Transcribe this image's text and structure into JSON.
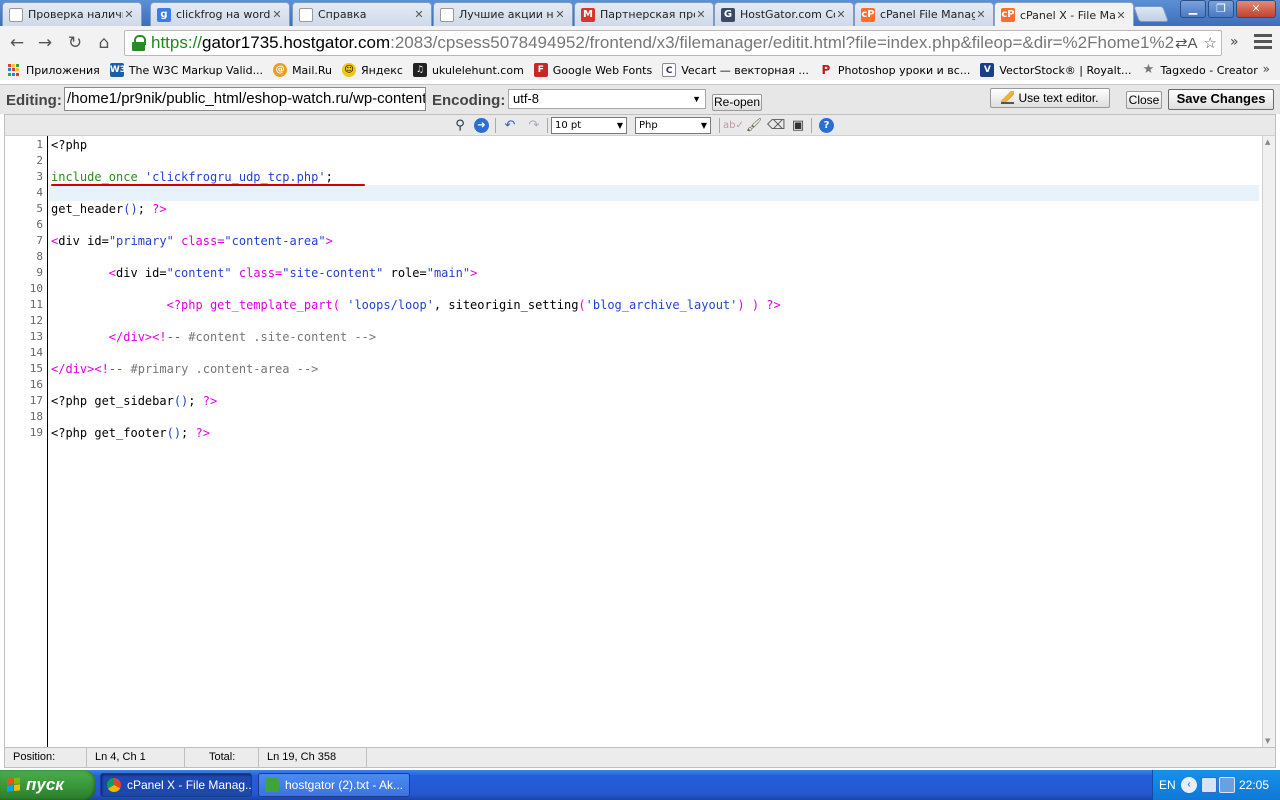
{
  "browser": {
    "tabs": [
      {
        "title": "Проверка наличи",
        "favicon": "doc-icon",
        "color": "#7a7a7a"
      },
      {
        "title": "clickfrog на wordp",
        "favicon": "google-icon",
        "color": "#3b7bea"
      },
      {
        "title": "Справка",
        "favicon": "doc-icon",
        "color": "#7a7a7a"
      },
      {
        "title": "Лучшие акции на",
        "favicon": "doc-icon",
        "color": "#7a7a7a"
      },
      {
        "title": "Партнерская прог",
        "favicon": "m-icon",
        "color": "#d6362b"
      },
      {
        "title": "HostGator.com Co",
        "favicon": "gator-icon",
        "color": "#3a4a66"
      },
      {
        "title": "cPanel File Manag",
        "favicon": "cpanel-icon",
        "color": "#ff6c2c"
      },
      {
        "title": "cPanel X - File Ma",
        "favicon": "cpanel-icon",
        "color": "#ff6c2c"
      }
    ],
    "url": {
      "scheme": "https://",
      "host": "gator1735.hostgator.com",
      "rest": ":2083/cpsess5078494952/frontend/x3/filemanager/editit.html?file=index.php&fileop=&dir=%2Fhome1%2F"
    },
    "bookmarks_apps_label": "Приложения",
    "bookmarks": [
      {
        "label": "The W3C Markup Valid...",
        "icon": "w3c-icon",
        "color": "#1a5fa8",
        "glyph": "W3"
      },
      {
        "label": "Mail.Ru",
        "icon": "mailru-icon",
        "color": "#1a6fd0",
        "glyph": "@"
      },
      {
        "label": "Яндекс",
        "icon": "smiley-icon",
        "color": "#e8c21a",
        "glyph": "☺"
      },
      {
        "label": "ukulelehunt.com",
        "icon": "ukulele-icon",
        "color": "#222222",
        "glyph": "♫"
      },
      {
        "label": "Google Web Fonts",
        "icon": "fonts-icon",
        "color": "#c62828",
        "glyph": "F"
      },
      {
        "label": "Vecart — векторная ...",
        "icon": "vecart-icon",
        "color": "#6a7a8a",
        "glyph": "C"
      },
      {
        "label": "Photoshop уроки и вс...",
        "icon": "photoshop-icon",
        "color": "#b71c1c",
        "glyph": "P"
      },
      {
        "label": "VectorStock® | Royalt...",
        "icon": "vectorstock-icon",
        "color": "#1a3e8a",
        "glyph": "V"
      },
      {
        "label": "Tagxedo - Creator",
        "icon": "star-icon",
        "color": "#777777",
        "glyph": "★"
      }
    ]
  },
  "editor": {
    "editing_label": "Editing:",
    "path_value": "/home1/pr9nik/public_html/eshop-watch.ru/wp-content",
    "encoding_label": "Encoding:",
    "encoding_value": "utf-8",
    "reopen_label": "Re-open",
    "use_text_editor_label": "Use text editor.",
    "close_label": "Close",
    "save_label": "Save Changes",
    "font_size": "10 pt",
    "syntax": "Php",
    "line_numbers": [
      "1",
      "2",
      "3",
      "4",
      "5",
      "6",
      "7",
      "8",
      "9",
      "10",
      "11",
      "12",
      "13",
      "14",
      "15",
      "16",
      "17",
      "18",
      "19"
    ],
    "code": {
      "l1": "<?php",
      "l3_fn": "include_once",
      "l3_str": "'clickfrogru_udp_tcp.php'",
      "l3_end": ";",
      "l5_fn": "get_header",
      "l5_par": "()",
      "l5_end": "; ",
      "l5_close": "?>",
      "l7_open": "<",
      "l7_tag": "div id=",
      "l7_v1": "\"primary\"",
      "l7_a2": " class=",
      "l7_v2": "\"content-area\"",
      "l7_close": ">",
      "l9_indent": "        ",
      "l9_open": "<",
      "l9_tag": "div id=",
      "l9_v1": "\"content\"",
      "l9_a2": " class=",
      "l9_v2": "\"site-content\"",
      "l9_a3": " role=",
      "l9_v3": "\"main\"",
      "l9_close": ">",
      "l11_indent": "                ",
      "l11_open": "<?php get_template_part",
      "l11_p1": "(",
      "l11_s1": " 'loops/loop'",
      "l11_mid": ", siteorigin_setting",
      "l11_p2": "(",
      "l11_s2": "'blog_archive_layout'",
      "l11_p3": ") )",
      "l11_end": " ?>",
      "l13_indent": "        ",
      "l13_tag": "</div>",
      "l13_cm_open": "<!--",
      "l13_cm": " #content .site-content ",
      "l13_cm_close": "-->",
      "l15_tag": "</div>",
      "l15_cm_open": "<!--",
      "l15_cm": " #primary .content-area ",
      "l15_cm_close": "-->",
      "l17_a": "<?php get_sidebar",
      "l17_p": "()",
      "l17_b": "; ",
      "l17_c": "?>",
      "l19_a": "<?php get_footer",
      "l19_p": "()",
      "l19_b": "; ",
      "l19_c": "?>"
    },
    "status": {
      "position_label": "Position:",
      "position_value": "Ln 4, Ch 1",
      "total_label": "Total:",
      "total_value": "Ln 19, Ch 358"
    }
  },
  "taskbar": {
    "start_label": "пуск",
    "tasks": [
      {
        "label": "cPanel X - File Manag...",
        "icon": "chrome-icon"
      },
      {
        "label": "hostgator (2).txt - Ak...",
        "icon": "notepad-icon"
      }
    ],
    "language": "EN",
    "clock": "22:05"
  }
}
